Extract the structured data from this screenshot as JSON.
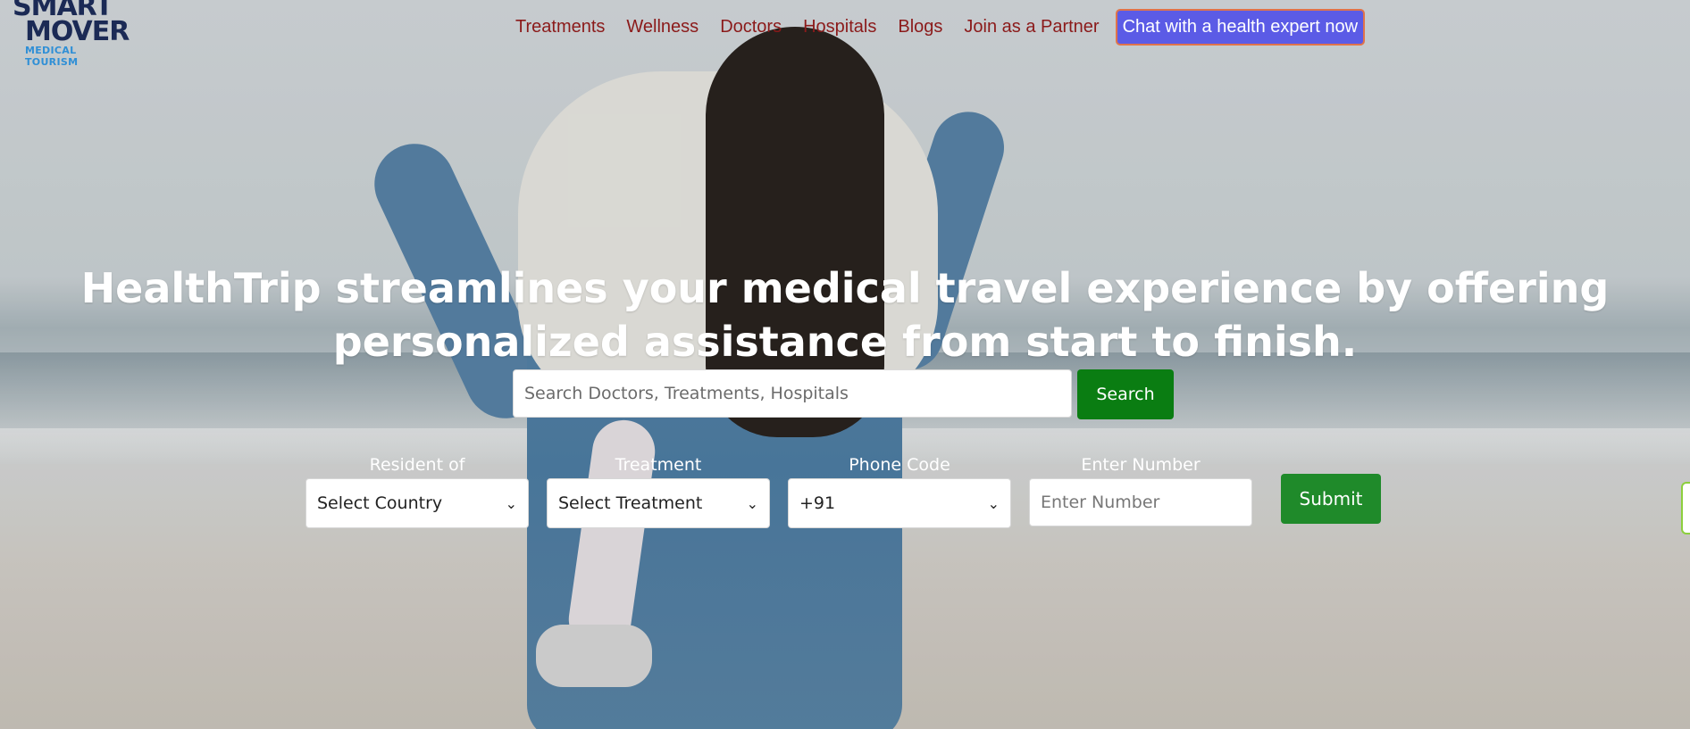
{
  "brand": {
    "line1": "SMART",
    "line2": "MOVER",
    "line3": "MEDICAL TOURISM"
  },
  "nav": {
    "items": [
      "Treatments",
      "Wellness",
      "Doctors",
      "Hospitals",
      "Blogs",
      "Join as a Partner"
    ],
    "cta": "Chat with a health expert now"
  },
  "hero": {
    "headline": "HealthTrip streamlines your medical travel experience by offering personalized assistance from start to finish."
  },
  "search": {
    "placeholder": "Search Doctors, Treatments, Hospitals",
    "button": "Search"
  },
  "form": {
    "resident_label": "Resident of",
    "resident_value": "Select Country",
    "treatment_label": "Treatment",
    "treatment_value": "Select Treatment",
    "phone_label": "Phone Code",
    "phone_value": "+91",
    "number_label": "Enter Number",
    "number_placeholder": "Enter Number",
    "submit": "Submit"
  },
  "colors": {
    "nav_link": "#8b1a1a",
    "cta_bg": "#5b5be6",
    "search_btn": "#0a7d12",
    "submit_btn": "#1f8a2a",
    "brand_dark": "#1b2a55",
    "brand_accent": "#2f8fd6"
  }
}
